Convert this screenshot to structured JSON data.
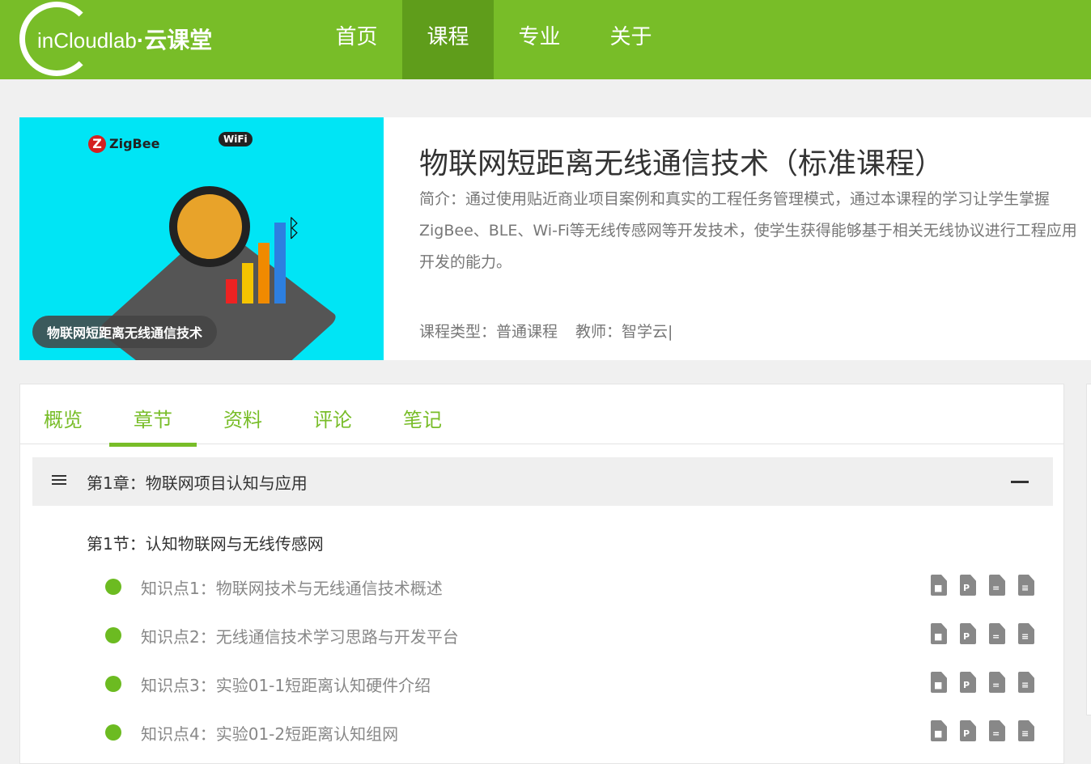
{
  "header": {
    "logo_text": "inCloudlab",
    "logo_cn": "·云课堂",
    "nav": [
      "首页",
      "课程",
      "专业",
      "关于"
    ],
    "active_nav": 1
  },
  "course": {
    "cover": {
      "zigbee": "ZigBee",
      "wifi": "WiFi",
      "caption": "物联网短距离无线通信技术"
    },
    "title": "物联网短距离无线通信技术（标准课程）",
    "description": "简介：通过使用贴近商业项目案例和真实的工程任务管理模式，通过本课程的学习让学生掌握ZigBee、BLE、Wi-Fi等无线传感网等开发技术，使学生获得能够基于相关无线协议进行工程应用开发的能力。",
    "type": "课程类型：普通课程",
    "teacher": "教师：智学云|"
  },
  "tabs": [
    "概览",
    "章节",
    "资料",
    "评论",
    "笔记"
  ],
  "active_tab": 1,
  "chapter": {
    "label": "第1章：物联网项目认知与应用",
    "section": "第1节：认知物联网与无线传感网",
    "points": [
      "知识点1：物联网技术与无线通信技术概述",
      "知识点2：无线通信技术学习思路与开发平台",
      "知识点3：实验01-1短距离认知硬件介绍",
      "知识点4：实验01-2短距离认知组网"
    ]
  },
  "resource_icons": [
    "video-file-icon",
    "ppt-file-icon",
    "document-file-icon",
    "notes-icon"
  ],
  "colors": {
    "brand": "#78bd28",
    "nav_active": "#5f9d1b",
    "cover_bg": "#00e5f5"
  }
}
